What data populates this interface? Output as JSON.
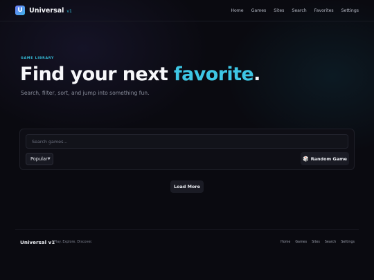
{
  "header": {
    "logo_letter": "U",
    "brand": "Universal",
    "version": "v1",
    "nav": [
      "Home",
      "Games",
      "Sites",
      "Search",
      "Favorites",
      "Settings"
    ]
  },
  "hero": {
    "eyebrow": "GAME LIBRARY",
    "headline_main": "Find your next ",
    "headline_accent": "favorite",
    "headline_end": ".",
    "subtitle": "Search, filter, sort, and jump into something fun."
  },
  "controls": {
    "search_placeholder": "Search games...",
    "sort_selected": "Popular",
    "random_label": "Random Game",
    "random_icon": "die-icon"
  },
  "load_more_label": "Load More",
  "footer": {
    "brand": "Universal v1",
    "tagline": "Play. Explore. Discover.",
    "links": [
      "Home",
      "Games",
      "Sites",
      "Search",
      "Settings"
    ]
  },
  "colors": {
    "accent": "#3ec6e4",
    "background": "#0a0a10"
  }
}
